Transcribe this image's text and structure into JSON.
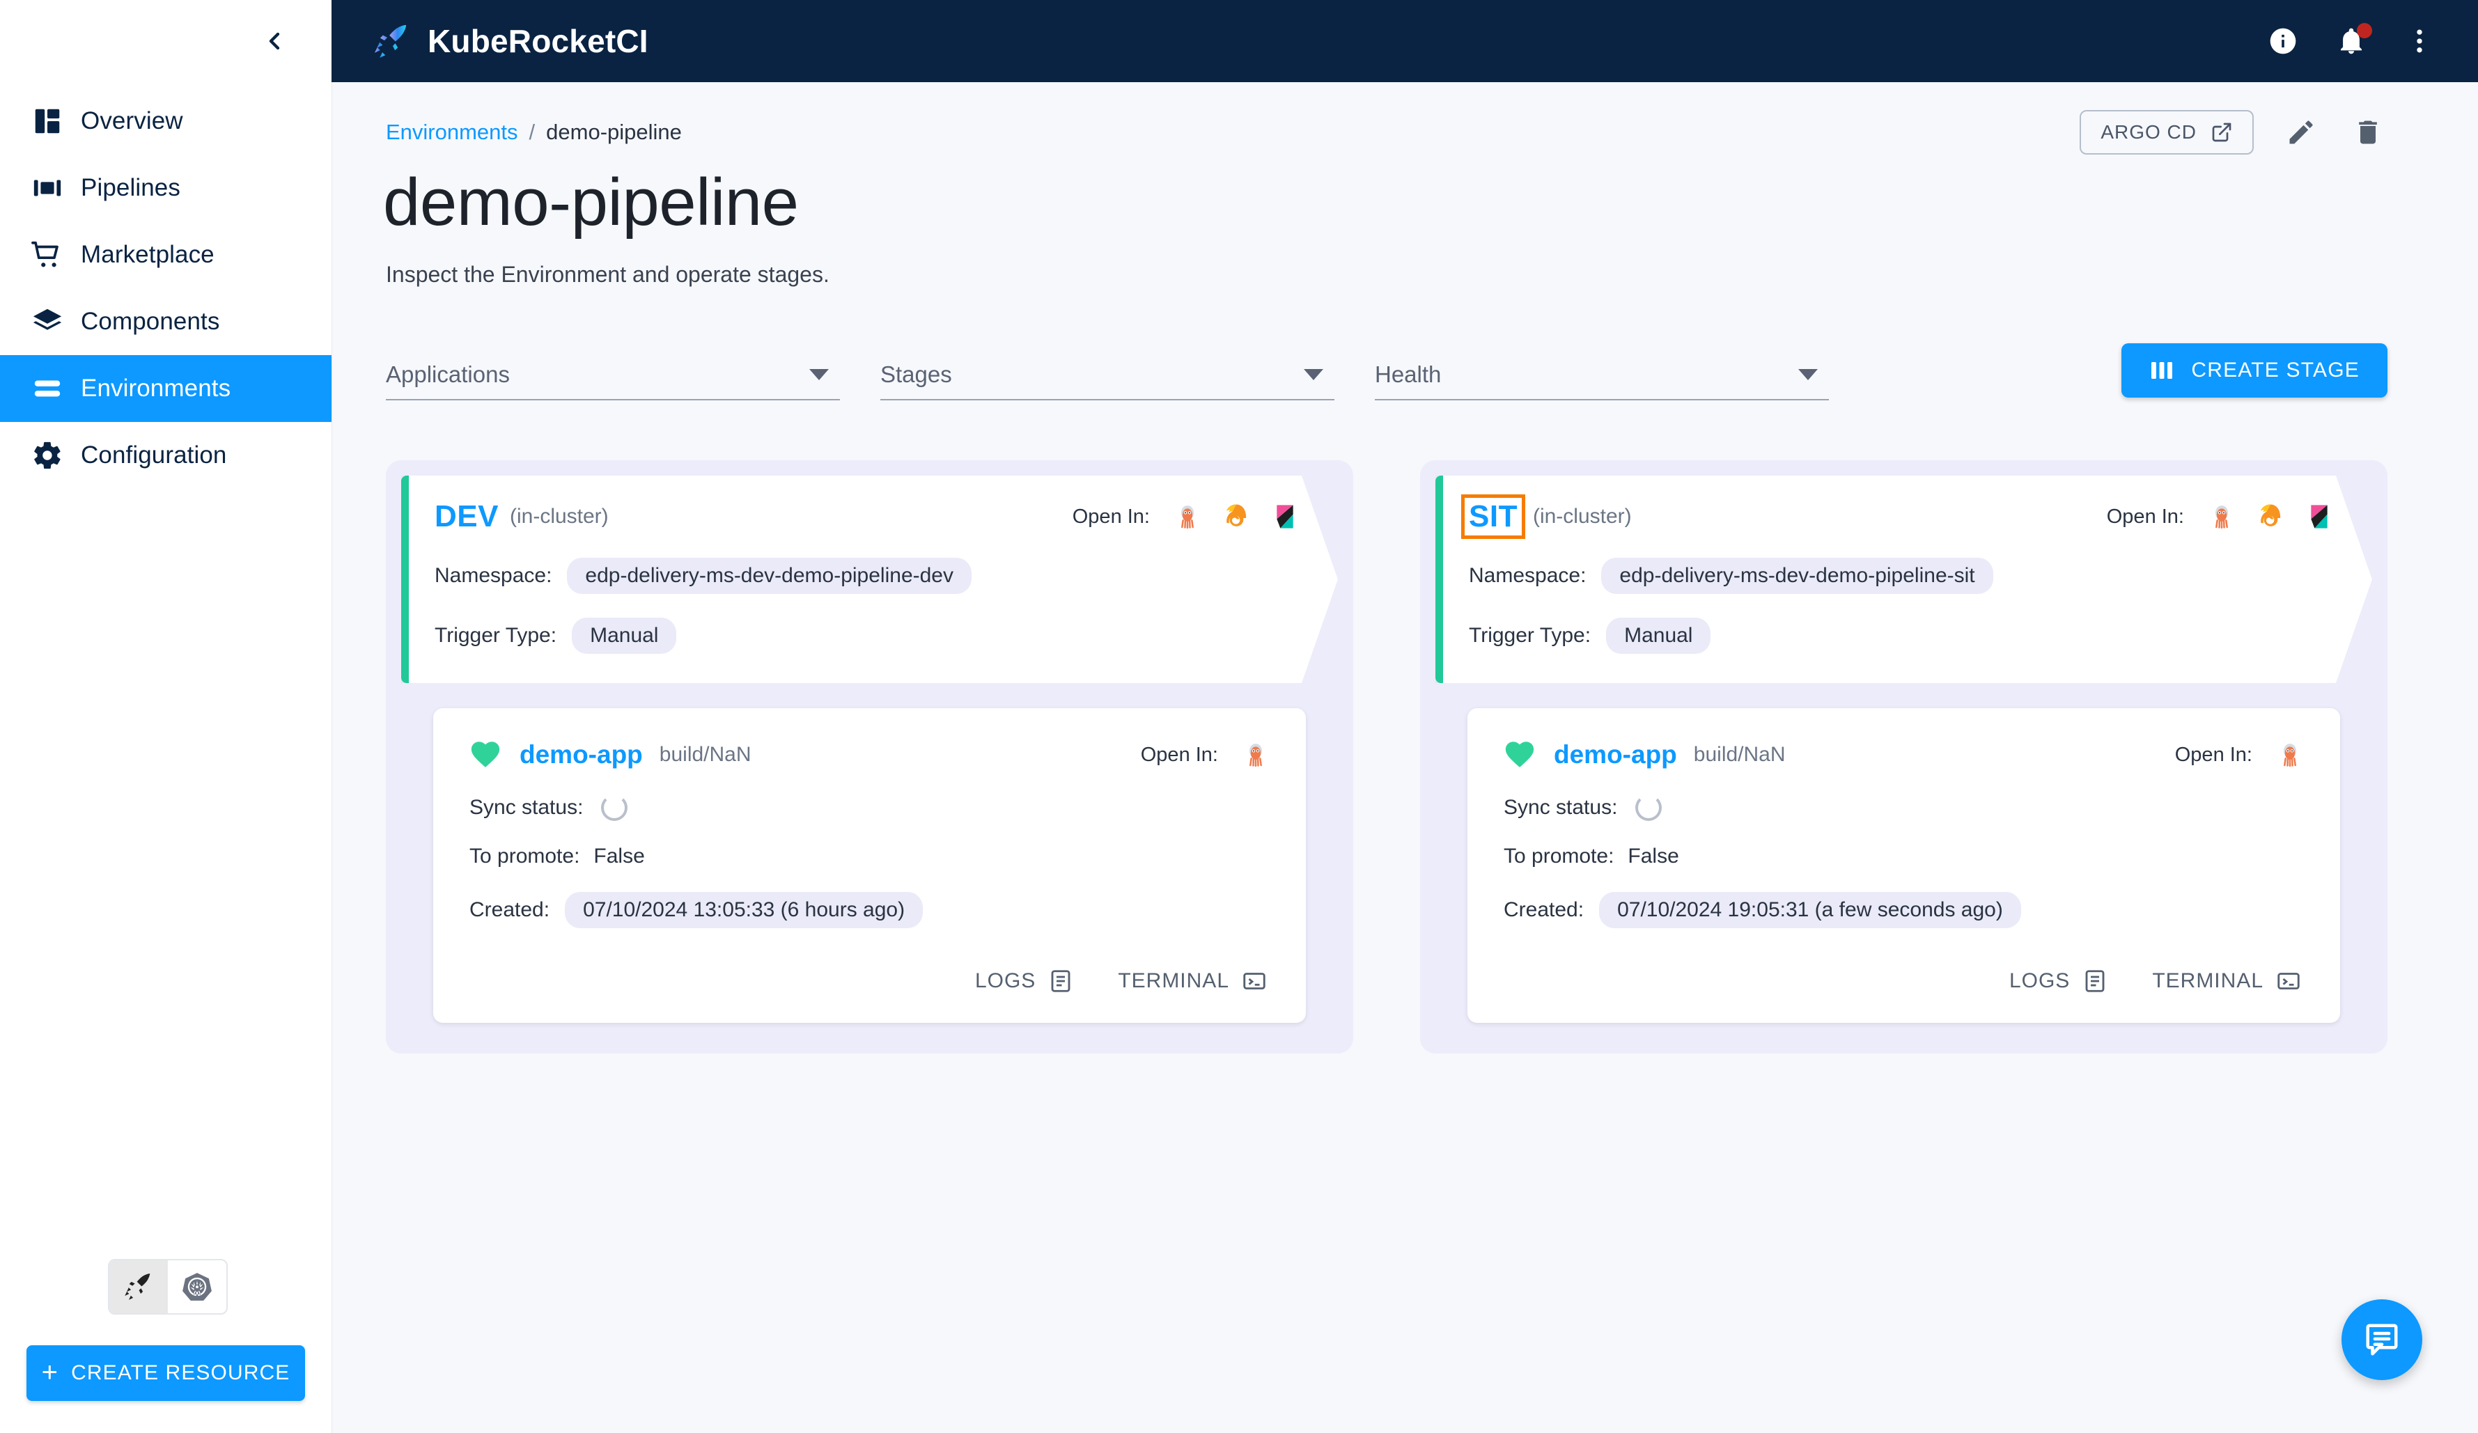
{
  "app": {
    "brand_name": "KubeRocketCI",
    "logo_icon": "rocket-pen-logo"
  },
  "topbar": {
    "info_icon": "info-circle-icon",
    "notifications_icon": "bell-icon",
    "overflow_icon": "more-vertical-icon"
  },
  "sidebar": {
    "collapse_icon": "chevron-left-icon",
    "items": [
      {
        "label": "Overview",
        "icon": "dashboard-icon",
        "active": false
      },
      {
        "label": "Pipelines",
        "icon": "pipelines-icon",
        "active": false
      },
      {
        "label": "Marketplace",
        "icon": "cart-icon",
        "active": false
      },
      {
        "label": "Components",
        "icon": "layers-icon",
        "active": false
      },
      {
        "label": "Environments",
        "icon": "environments-icon",
        "active": true
      },
      {
        "label": "Configuration",
        "icon": "gear-icon",
        "active": false
      }
    ],
    "view_toggle": [
      {
        "icon": "rocket-pen-icon",
        "selected": true
      },
      {
        "icon": "kubernetes-icon",
        "selected": false
      }
    ],
    "create_resource_label": "CREATE RESOURCE"
  },
  "breadcrumb": {
    "root_label": "Environments",
    "separator": "/",
    "current_label": "demo-pipeline"
  },
  "header_actions": {
    "argo_cd_label": "ARGO CD",
    "argo_cd_icon": "external-link-icon",
    "edit_icon": "pencil-icon",
    "delete_icon": "trash-icon"
  },
  "page": {
    "title": "demo-pipeline",
    "subtitle": "Inspect the Environment and operate stages."
  },
  "filters": {
    "applications": {
      "label": "Applications",
      "value": "Applications"
    },
    "stages": {
      "label": "Stages",
      "value": "Stages"
    },
    "health": {
      "label": "Health",
      "value": "Health"
    },
    "caret_icon": "chevron-down-icon"
  },
  "create_stage": {
    "label": "CREATE STAGE",
    "icon": "columns-icon"
  },
  "labels": {
    "namespace": "Namespace:",
    "trigger_type": "Trigger Type:",
    "open_in": "Open In:",
    "sync_status": "Sync status:",
    "to_promote": "To promote:",
    "created": "Created:",
    "logs": "LOGS",
    "terminal": "TERMINAL"
  },
  "stages": [
    {
      "name": "DEV",
      "cluster": "(in-cluster)",
      "focused": false,
      "namespace": "edp-delivery-ms-dev-demo-pipeline-dev",
      "trigger_type": "Manual",
      "open_in": [
        "argocd-icon",
        "grafana-icon",
        "kibana-icon"
      ],
      "application": {
        "health_icon": "heart-icon",
        "name": "demo-app",
        "build": "build/NaN",
        "open_in": [
          "argocd-icon"
        ],
        "sync_status_icon": "spinner-icon",
        "to_promote": "False",
        "created": "07/10/2024 13:05:33 (6 hours ago)"
      }
    },
    {
      "name": "SIT",
      "cluster": "(in-cluster)",
      "focused": true,
      "namespace": "edp-delivery-ms-dev-demo-pipeline-sit",
      "trigger_type": "Manual",
      "open_in": [
        "argocd-icon",
        "grafana-icon",
        "kibana-icon"
      ],
      "application": {
        "health_icon": "heart-icon",
        "name": "demo-app",
        "build": "build/NaN",
        "open_in": [
          "argocd-icon"
        ],
        "sync_status_icon": "spinner-icon",
        "to_promote": "False",
        "created": "07/10/2024 19:05:31 (a few seconds ago)"
      }
    }
  ],
  "fab": {
    "icon": "chat-icon"
  },
  "colors": {
    "accent_blue": "#0D99FF",
    "topbar_navy": "#0A2342",
    "stage_accent_green": "#20C997",
    "focus_orange": "#F57C00",
    "notification_red": "#C0261F",
    "chip_lavender": "#EAEAF8",
    "stage_panel": "#ECECFB",
    "page_bg": "#F6F8FC"
  }
}
